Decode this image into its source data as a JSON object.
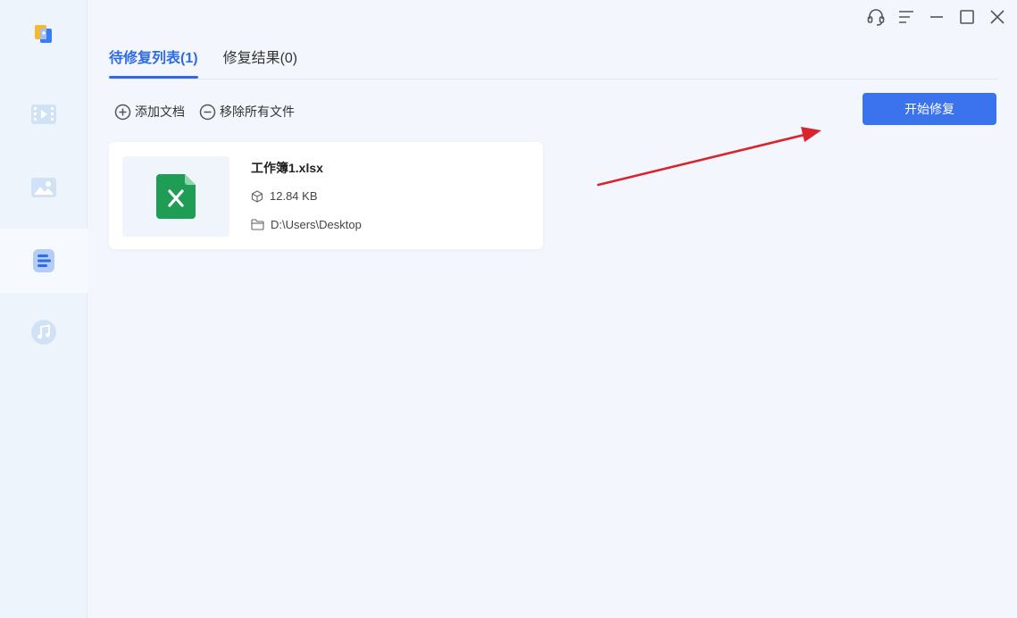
{
  "sidebar": {
    "items": [
      {
        "name": "app-logo-icon",
        "active": false
      },
      {
        "name": "video-icon",
        "active": false
      },
      {
        "name": "image-icon",
        "active": false
      },
      {
        "name": "document-icon",
        "active": true
      },
      {
        "name": "music-icon",
        "active": false
      }
    ]
  },
  "window_controls": [
    "headset-icon",
    "menu-icon",
    "minimize-icon",
    "maximize-icon",
    "close-icon"
  ],
  "tabs": [
    {
      "label": "待修复列表(1)",
      "active": true
    },
    {
      "label": "修复结果(0)",
      "active": false
    }
  ],
  "toolbar": {
    "add_label": "添加文档",
    "remove_all_label": "移除所有文件"
  },
  "start_button": {
    "label": "开始修复"
  },
  "file": {
    "name": "工作簿1.xlsx",
    "size": "12.84 KB",
    "path": "D:\\Users\\Desktop"
  },
  "colors": {
    "accent": "#3a73ec",
    "excel_green": "#1f9d55",
    "annotation_arrow": "#d9232d"
  }
}
